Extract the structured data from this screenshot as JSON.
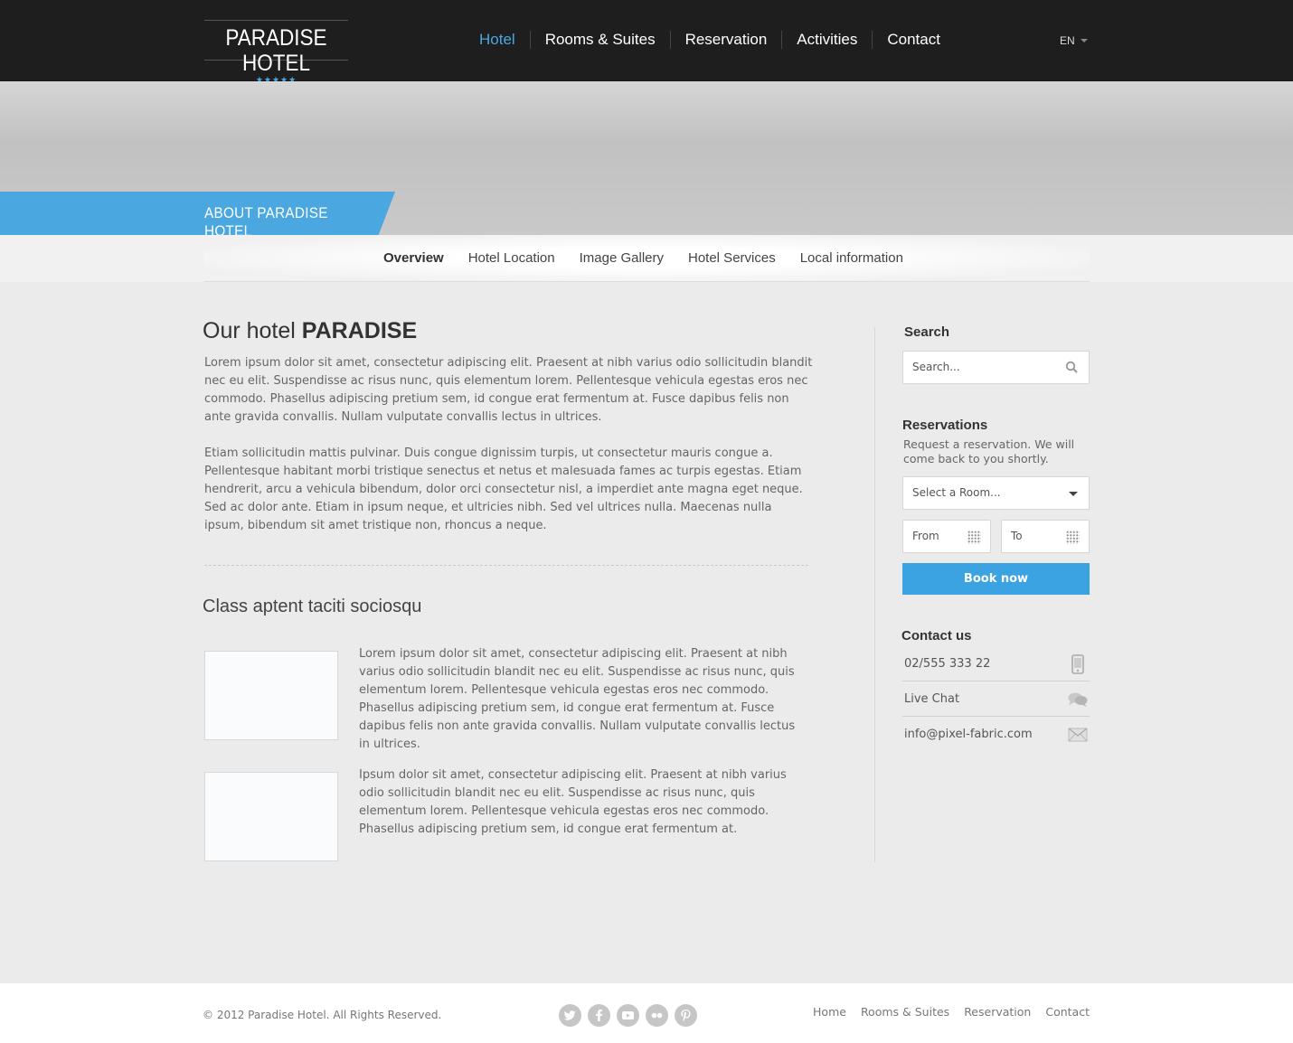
{
  "header": {
    "logo_text": "PARADISE HOTEL",
    "logo_stars": "★★★★★",
    "nav": [
      "Hotel",
      "Rooms & Suites",
      "Reservation",
      "Activities",
      "Contact"
    ],
    "active_nav": "Hotel",
    "language": "EN"
  },
  "hero": {
    "label": "ABOUT PARADISE HOTEL"
  },
  "subnav": [
    "Overview",
    "Hotel Location",
    "Image Gallery",
    "Hotel Services",
    "Local information"
  ],
  "main": {
    "title_light": "Our hotel ",
    "title_bold": "PARADISE",
    "para1": "Lorem ipsum dolor sit amet, consectetur adipiscing elit. Praesent at nibh varius odio sollicitudin blandit nec eu elit. Suspendisse ac risus nunc, quis elementum lorem. Pellentesque vehicula egestas eros nec commodo. Phasellus adipiscing pretium sem, id congue erat fermentum at. Fusce dapibus felis non ante gravida convallis. Nullam vulputate convallis lectus in ultrices.",
    "para2": "Etiam sollicitudin mattis pulvinar. Duis congue dignissim turpis, ut consectetur mauris congue a. Pellentesque habitant morbi tristique senectus et netus et malesuada fames ac turpis egestas. Etiam hendrerit, arcu a vehicula bibendum, dolor orci consectetur nisl, a imperdiet ante magna eget neque. Sed ac dolor ante. Etiam in ipsum neque, et ultricies nibh. Sed vel ultrices nulla. Maecenas nulla ipsum, bibendum sit amet tristique non, rhoncus a neque.",
    "subtitle": "Class aptent taciti sociosqu",
    "item1": "Lorem ipsum dolor sit amet, consectetur adipiscing elit. Praesent at nibh varius odio sollicitudin blandit nec eu elit. Suspendisse ac risus nunc, quis elementum lorem. Pellentesque vehicula egestas eros nec commodo. Phasellus adipiscing pretium sem, id congue erat fermentum at. Fusce dapibus felis non ante gravida convallis. Nullam vulputate convallis lectus in ultrices.",
    "item2": "Ipsum dolor sit amet, consectetur adipiscing elit. Praesent at nibh varius odio sollicitudin blandit nec eu elit. Suspendisse ac risus nunc, quis elementum lorem. Pellentesque vehicula egestas eros nec commodo. Phasellus adipiscing pretium sem, id congue erat fermentum at."
  },
  "sidebar": {
    "search_title": "Search",
    "search_placeholder": "Search...",
    "res_title": "Reservations",
    "res_text": "Request a reservation. We will come back to you shortly.",
    "room_select": "Select a Room...",
    "from": "From",
    "to": "To",
    "book": "Book now",
    "contact_title": "Contact us",
    "phone": "02/555 333 22",
    "chat": "Live Chat",
    "email": "info@pixel-fabric.com"
  },
  "footer": {
    "copyright": "© 2012 Paradise Hotel. All Rights Reserved.",
    "social": [
      "twitter-icon",
      "facebook-icon",
      "youtube-icon",
      "flickr-icon",
      "pinterest-icon"
    ],
    "nav": [
      "Home",
      "Rooms & Suites",
      "Reservation",
      "Contact"
    ]
  },
  "colors": {
    "accent": "#4aa7e0",
    "header_bg": "#1e1e1e",
    "button": "#3ca3e3"
  }
}
